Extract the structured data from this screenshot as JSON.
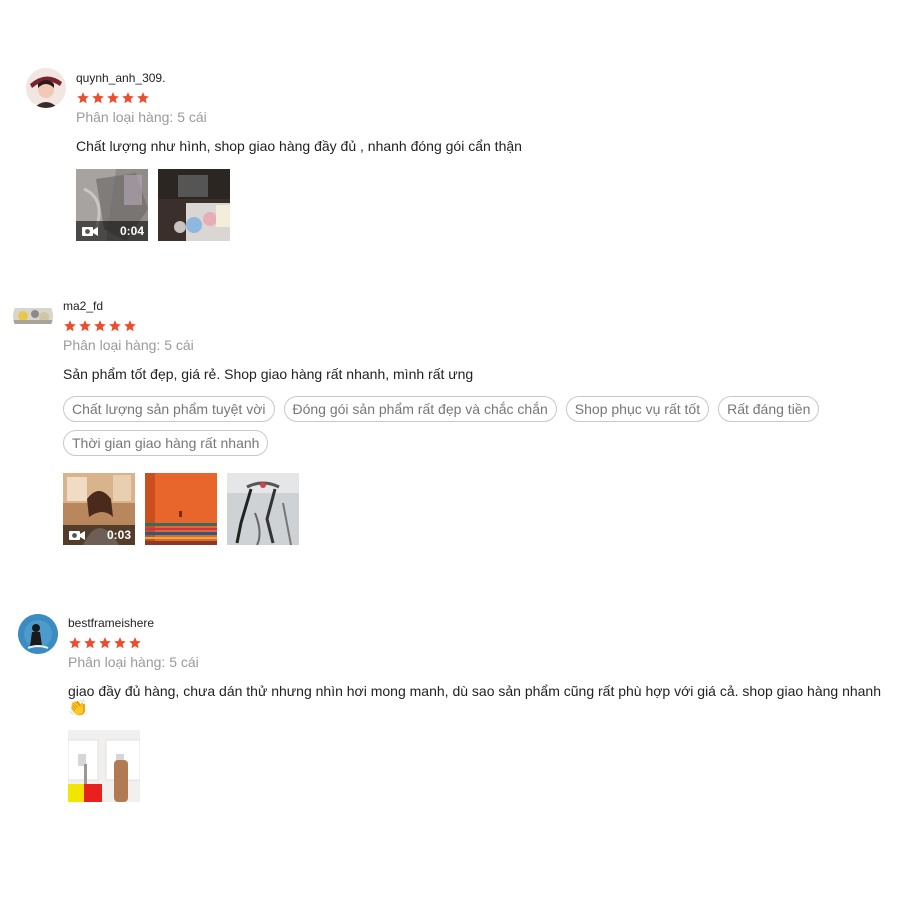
{
  "colors": {
    "star": "#ee4d2d",
    "tag_border": "#c9c9c9",
    "muted": "#9a9a9a"
  },
  "reviews": [
    {
      "username": "quynh_anh_309.",
      "rating": 5,
      "variation": "Phân loại hàng: 5 cái",
      "comment": "Chất lượng như hình, shop giao hàng đầy đủ , nhanh đóng gói cẩn thận",
      "tags": [],
      "media": [
        {
          "type": "video",
          "duration": "0:04"
        },
        {
          "type": "image"
        }
      ]
    },
    {
      "username": "ma2_fd",
      "rating": 5,
      "variation": "Phân loại hàng: 5 cái",
      "comment": "Sản phẩm tốt đẹp, giá rẻ. Shop giao hàng rất nhanh, mình rất ưng",
      "tags": [
        "Chất lượng sản phẩm tuyệt vời",
        "Đóng gói sản phẩm rất đẹp và chắc chắn",
        "Shop phục vụ rất tốt",
        "Rất đáng tiền",
        "Thời gian giao hàng rất nhanh"
      ],
      "media": [
        {
          "type": "video",
          "duration": "0:03"
        },
        {
          "type": "image"
        },
        {
          "type": "image"
        }
      ]
    },
    {
      "username": "bestframeishere",
      "rating": 5,
      "variation": "Phân loại hàng: 5 cái",
      "comment": "giao đầy đủ hàng, chưa dán thử nhưng nhìn hơi mong manh, dù sao sản phẩm cũng rất phù hợp với giá cả. shop giao hàng nhanh",
      "emoji": "👏",
      "tags": [],
      "media": [
        {
          "type": "image"
        }
      ]
    }
  ]
}
